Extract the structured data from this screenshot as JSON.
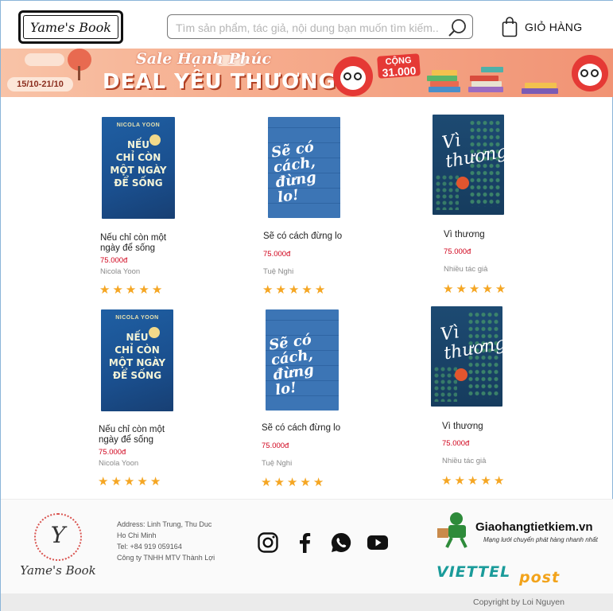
{
  "header": {
    "logo_text": "Yame's Book",
    "search_placeholder": "Tìm sản phẩm, tác giả, nội dung bạn muốn tìm kiếm...",
    "cart_label": "GIỎ HÀNG"
  },
  "banner": {
    "sale_text": "Sale Hạnh Phúc",
    "deal_text": "DEAL YÊU THƯƠNG",
    "date_range": "15/10-21/10",
    "badge_top": "CỘNG",
    "badge_value": "31.000"
  },
  "products": [
    {
      "name": "Nếu chỉ còn một ngày để sống",
      "price": "75.000đ",
      "author": "Nicola Yoon",
      "rating": 5,
      "cover": "nc"
    },
    {
      "name": "Sẽ có cách đừng lo",
      "price": "75.000đ",
      "author": "Tuệ Nghi",
      "rating": 5,
      "cover": "sc"
    },
    {
      "name": "Vì thương",
      "price": "75.000đ",
      "author": "Nhiều tác giả",
      "rating": 5,
      "cover": "vt"
    },
    {
      "name": "Nếu chỉ còn một ngày để sống",
      "price": "75.000đ",
      "author": "Nicola Yoon",
      "rating": 5,
      "cover": "nc"
    },
    {
      "name": "Sẽ có cách đừng lo",
      "price": "75.000đ",
      "author": "Tuệ Nghi",
      "rating": 5,
      "cover": "sc"
    },
    {
      "name": "Vì thương",
      "price": "75.000đ",
      "author": "Nhiều tác giả",
      "rating": 5,
      "cover": "vt"
    }
  ],
  "covers": {
    "nc_author": "NICOLA YOON",
    "nc_title_lines": [
      "NẾU",
      "CHỈ CÒN",
      "MỘT NGÀY",
      "ĐỂ SỐNG"
    ],
    "sc_title": "Sẽ có cách, đừng lo!",
    "vt_title": "Vì thương"
  },
  "footer": {
    "brand_initial": "Y",
    "brand_name": "Yame's Book",
    "address_line1": "Address: Linh Trung, Thu Duc",
    "address_line2": "Ho Chi Minh",
    "phone": "Tel: +84 919 059164",
    "company": "Công ty TNHH MTV Thành Lợi",
    "socials": [
      "instagram-icon",
      "facebook-icon",
      "whatsapp-icon",
      "youtube-icon"
    ],
    "ghtk_name": "Giaohangtietkiem.vn",
    "ghtk_slogan": "Mạng lưới chuyển phát hàng nhanh nhất",
    "vtp_part1": "VIETTEL",
    "vtp_part2": "post",
    "copyright": "Copyright by Loi Nguyen"
  },
  "colors": {
    "price": "#d0021b",
    "star": "#f5a623",
    "banner": "#f6ad8e"
  }
}
